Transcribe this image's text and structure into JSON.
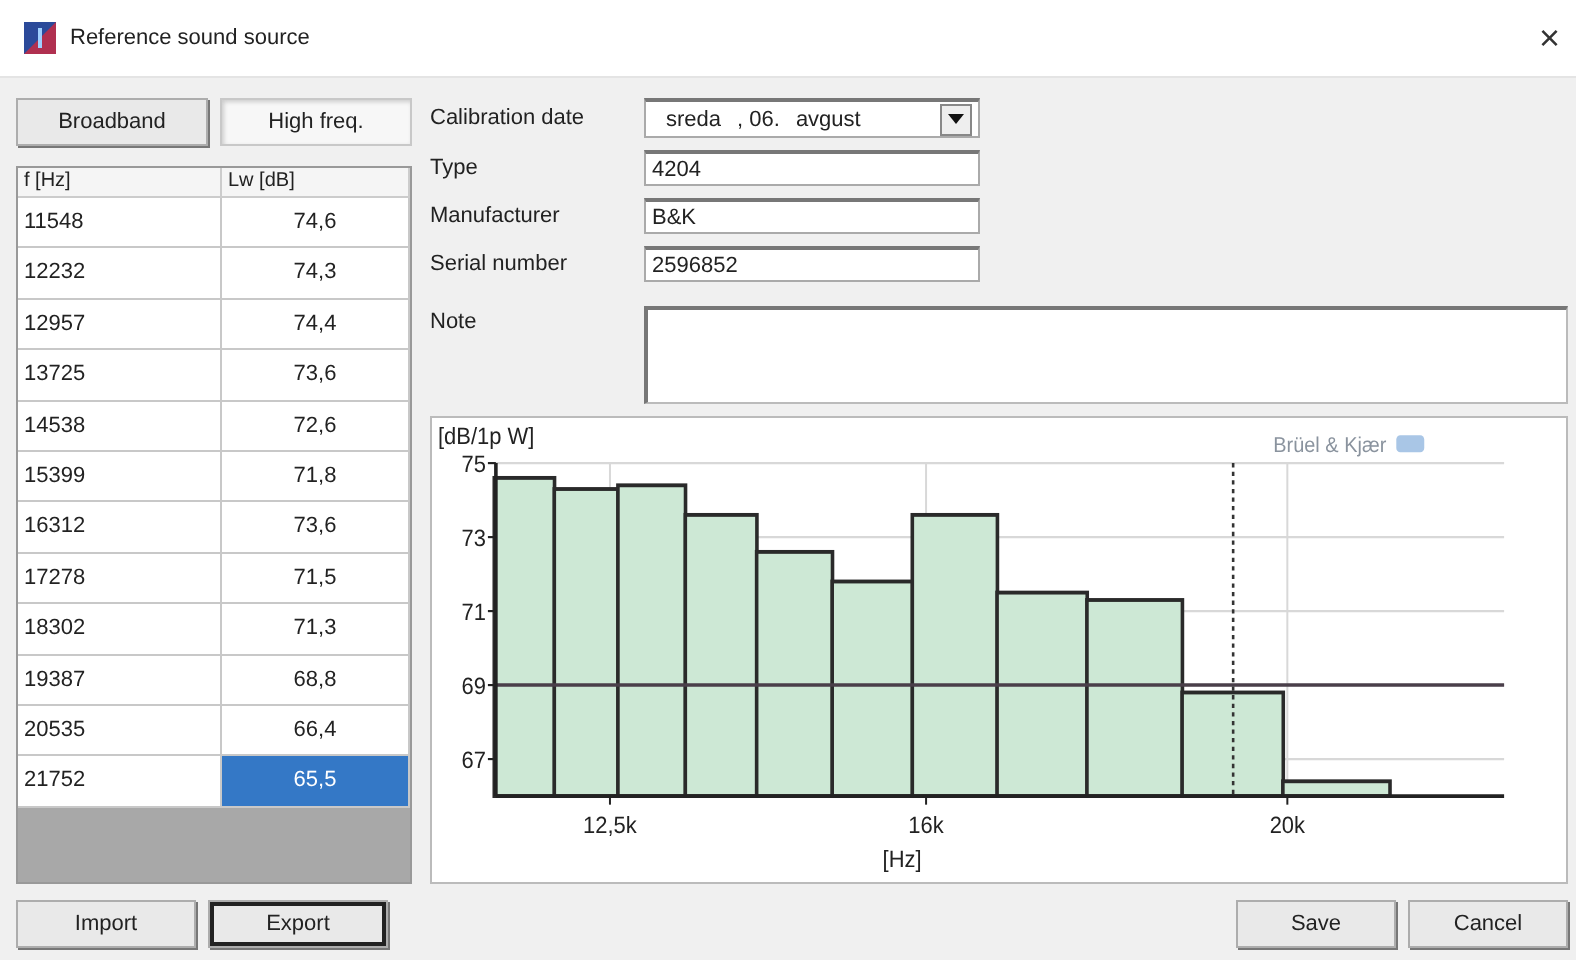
{
  "window": {
    "title": "Reference sound source",
    "close": "×"
  },
  "tabs": [
    {
      "label": "Broadband",
      "selected": false
    },
    {
      "label": "High freq.",
      "selected": true
    }
  ],
  "table": {
    "columns": [
      "f [Hz]",
      "Lw [dB]"
    ],
    "rows": [
      {
        "f": "11548",
        "lw": "74,6",
        "selected": false
      },
      {
        "f": "12232",
        "lw": "74,3",
        "selected": false
      },
      {
        "f": "12957",
        "lw": "74,4",
        "selected": false
      },
      {
        "f": "13725",
        "lw": "73,6",
        "selected": false
      },
      {
        "f": "14538",
        "lw": "72,6",
        "selected": false
      },
      {
        "f": "15399",
        "lw": "71,8",
        "selected": false
      },
      {
        "f": "16312",
        "lw": "73,6",
        "selected": false
      },
      {
        "f": "17278",
        "lw": "71,5",
        "selected": false
      },
      {
        "f": "18302",
        "lw": "71,3",
        "selected": false
      },
      {
        "f": "19387",
        "lw": "68,8",
        "selected": false
      },
      {
        "f": "20535",
        "lw": "66,4",
        "selected": false
      },
      {
        "f": "21752",
        "lw": "65,5",
        "selected": true
      }
    ]
  },
  "form": {
    "calibration_date": {
      "label": "Calibration date",
      "parts": [
        "sreda",
        ", 06.",
        "avgust"
      ]
    },
    "fields": [
      {
        "label": "Type",
        "value": "4204"
      },
      {
        "label": "Manufacturer",
        "value": "B&K"
      },
      {
        "label": "Serial number",
        "value": "2596852"
      }
    ],
    "note": {
      "label": "Note"
    }
  },
  "chart": {
    "unit_label": "[dB/1p W]",
    "brand": "Brüel & Kjær",
    "chart_data": {
      "type": "bar",
      "xlabel": "[Hz]",
      "x": [
        11548,
        12232,
        12957,
        13725,
        14538,
        15399,
        16312,
        17278,
        18302,
        19387,
        20535
      ],
      "values": [
        74.6,
        74.3,
        74.4,
        73.6,
        72.6,
        71.8,
        73.6,
        71.5,
        71.3,
        68.8,
        66.4
      ],
      "xlim": [
        11237,
        22400
      ],
      "ylim": [
        66,
        75
      ],
      "xticks": [
        {
          "value": 12500,
          "label": "12,5k"
        },
        {
          "value": 16000,
          "label": "16k"
        },
        {
          "value": 20000,
          "label": "20k"
        }
      ],
      "yticks": [
        67,
        69,
        71,
        73,
        75
      ],
      "grid": true,
      "ref_lines": [
        {
          "axis": "y",
          "value": 69
        },
        {
          "axis": "x",
          "value": 19400
        }
      ]
    }
  },
  "buttons": {
    "left": [
      {
        "label": "Import",
        "focused": false
      },
      {
        "label": "Export",
        "focused": true
      }
    ],
    "right": [
      {
        "label": "Save",
        "focused": false
      },
      {
        "label": "Cancel",
        "focused": false
      }
    ]
  }
}
